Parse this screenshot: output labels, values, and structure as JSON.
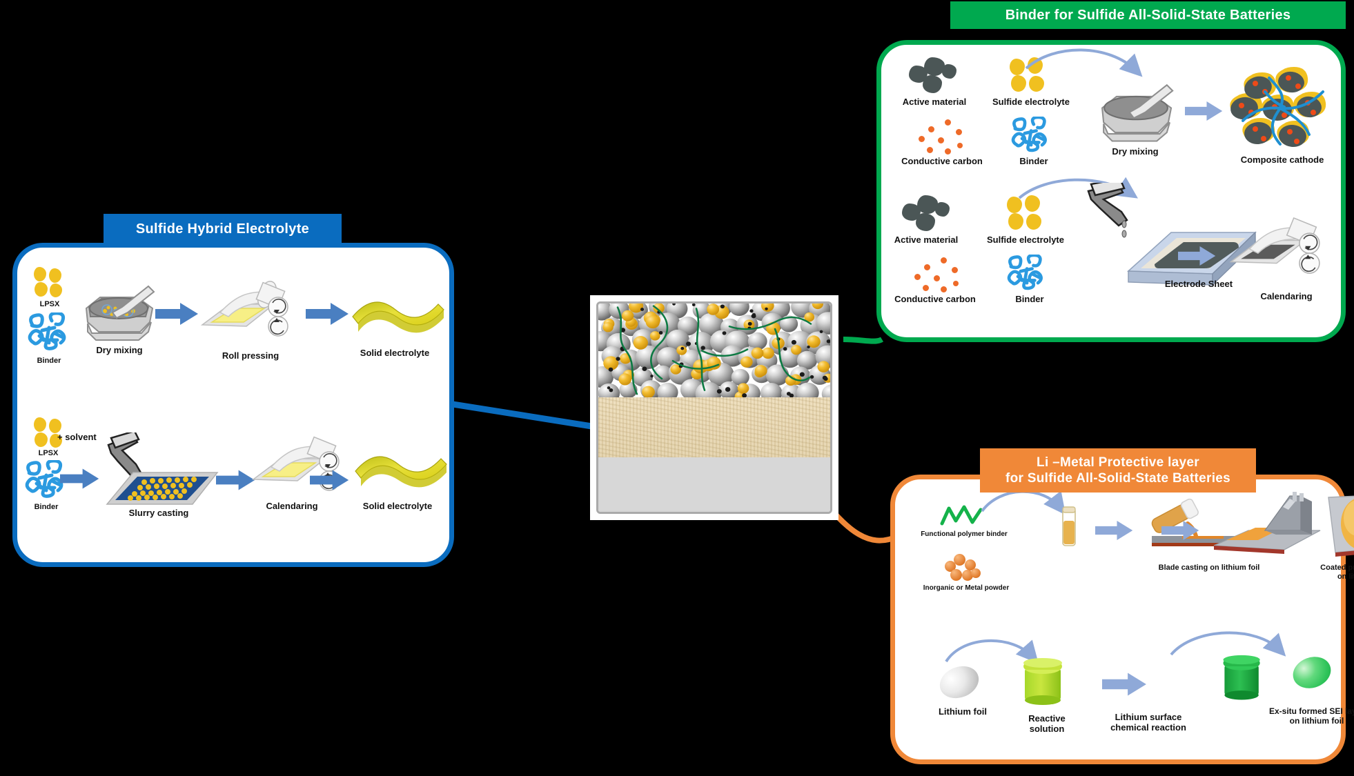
{
  "figure": {
    "type": "scientific-graphical-abstract",
    "background": "#000000",
    "colors": {
      "blue": "#0a6cbf",
      "green": "#00a94f",
      "orange": "#f08838",
      "arrow_blue": "#4a7fc1",
      "arrow_light_blue": "#8fa9d8",
      "gold": "#f0c020",
      "dark_particle": "#4b5656",
      "carbon_orange": "#ee6a28",
      "binder_blue": "#2b9ae0"
    }
  },
  "panels": {
    "blue": {
      "title": "Sulfide Hybrid Electrolyte",
      "rows": [
        {
          "name": "dry-process-route",
          "steps": [
            {
              "label": "LPSX",
              "icon": "gold-blobs-icon"
            },
            {
              "label": "Binder",
              "icon": "binder-network-icon"
            },
            {
              "label": "Dry mixing",
              "icon": "mortar-pestle-icon"
            },
            {
              "label": "Roll pressing",
              "icon": "calender-rollers-icon"
            },
            {
              "label": "Solid electrolyte",
              "icon": "yellow-film-icon"
            }
          ]
        },
        {
          "name": "wet-process-route",
          "steps": [
            {
              "label": "LPSX",
              "icon": "gold-blobs-icon"
            },
            {
              "label": "Binder",
              "icon": "binder-network-icon"
            },
            {
              "label": "+ solvent",
              "icon": "plus-solvent-label"
            },
            {
              "label": "Slurry casting",
              "icon": "beaker-pour-icon"
            },
            {
              "label": "Calendaring",
              "icon": "calender-rollers-icon"
            },
            {
              "label": "Solid electrolyte",
              "icon": "yellow-film-icon"
            }
          ]
        }
      ]
    },
    "green": {
      "title": "Binder for Sulfide All-Solid-State Batteries",
      "rows": [
        {
          "name": "dry-mixing-route",
          "ingredients": [
            {
              "label": "Active material",
              "icon": "dark-particles-icon"
            },
            {
              "label": "Sulfide electrolyte",
              "icon": "gold-blobs-icon"
            },
            {
              "label": "Conductive carbon",
              "icon": "carbon-dots-icon"
            },
            {
              "label": "Binder",
              "icon": "binder-network-icon"
            }
          ],
          "steps": [
            {
              "label": "Dry mixing",
              "icon": "mortar-pestle-icon"
            },
            {
              "label": "Composite cathode",
              "icon": "composite-cathode-icon"
            }
          ]
        },
        {
          "name": "slurry-route",
          "ingredients": [
            {
              "label": "Active material",
              "icon": "dark-particles-icon"
            },
            {
              "label": "Sulfide electrolyte",
              "icon": "gold-blobs-icon"
            },
            {
              "label": "Conductive carbon",
              "icon": "carbon-dots-icon"
            },
            {
              "label": "Binder",
              "icon": "binder-network-icon"
            }
          ],
          "steps": [
            {
              "label": "Electrode Sheet",
              "icon": "electrode-sheet-icon"
            },
            {
              "label": "Calendaring",
              "icon": "calender-rollers-icon"
            }
          ]
        }
      ]
    },
    "orange": {
      "title_line1": "Li –Metal Protective layer",
      "title_line2": "for Sulfide All-Solid-State Batteries",
      "rows": [
        {
          "name": "blade-casting-route",
          "steps": [
            {
              "label": "Functional polymer binder",
              "icon": "green-squiggle-icon"
            },
            {
              "label": "Inorganic or Metal powder",
              "icon": "orange-cluster-icon"
            },
            {
              "label": "Blade casting on lithium foil",
              "icon": "blade-caster-icon"
            },
            {
              "label": "Coated protective layer\non lithium foil",
              "icon": "coated-foil-icon"
            }
          ]
        },
        {
          "name": "ex-situ-sei-route",
          "steps": [
            {
              "label": "Lithium foil",
              "icon": "lithium-disc-icon"
            },
            {
              "label": "Reactive\nsolution",
              "icon": "green-yellow-jar-icon"
            },
            {
              "label": "Lithium surface\nchemical reaction",
              "icon": "reaction-arrow-icon"
            },
            {
              "label": "Ex-situ formed SEI layer\non lithium foil",
              "icon": "green-disc-icon"
            }
          ]
        }
      ]
    }
  },
  "center": {
    "name": "all-solid-state-cell-cross-section",
    "layers": [
      {
        "name": "composite-cathode-layer",
        "description": "grey and gold spheres with green binder fibers"
      },
      {
        "name": "sulfide-solid-electrolyte-layer",
        "description": "beige textured separator"
      },
      {
        "name": "lithium-metal-anode-layer",
        "description": "flat grey metal foil"
      }
    ]
  },
  "connectors": [
    {
      "name": "blue-connector",
      "from": "blue-panel",
      "to": "center",
      "color": "#0a6cbf"
    },
    {
      "name": "green-connector",
      "from": "green-panel",
      "to": "center",
      "color": "#00a94f"
    },
    {
      "name": "orange-connector",
      "from": "orange-panel",
      "to": "center",
      "color": "#f08838"
    }
  ]
}
